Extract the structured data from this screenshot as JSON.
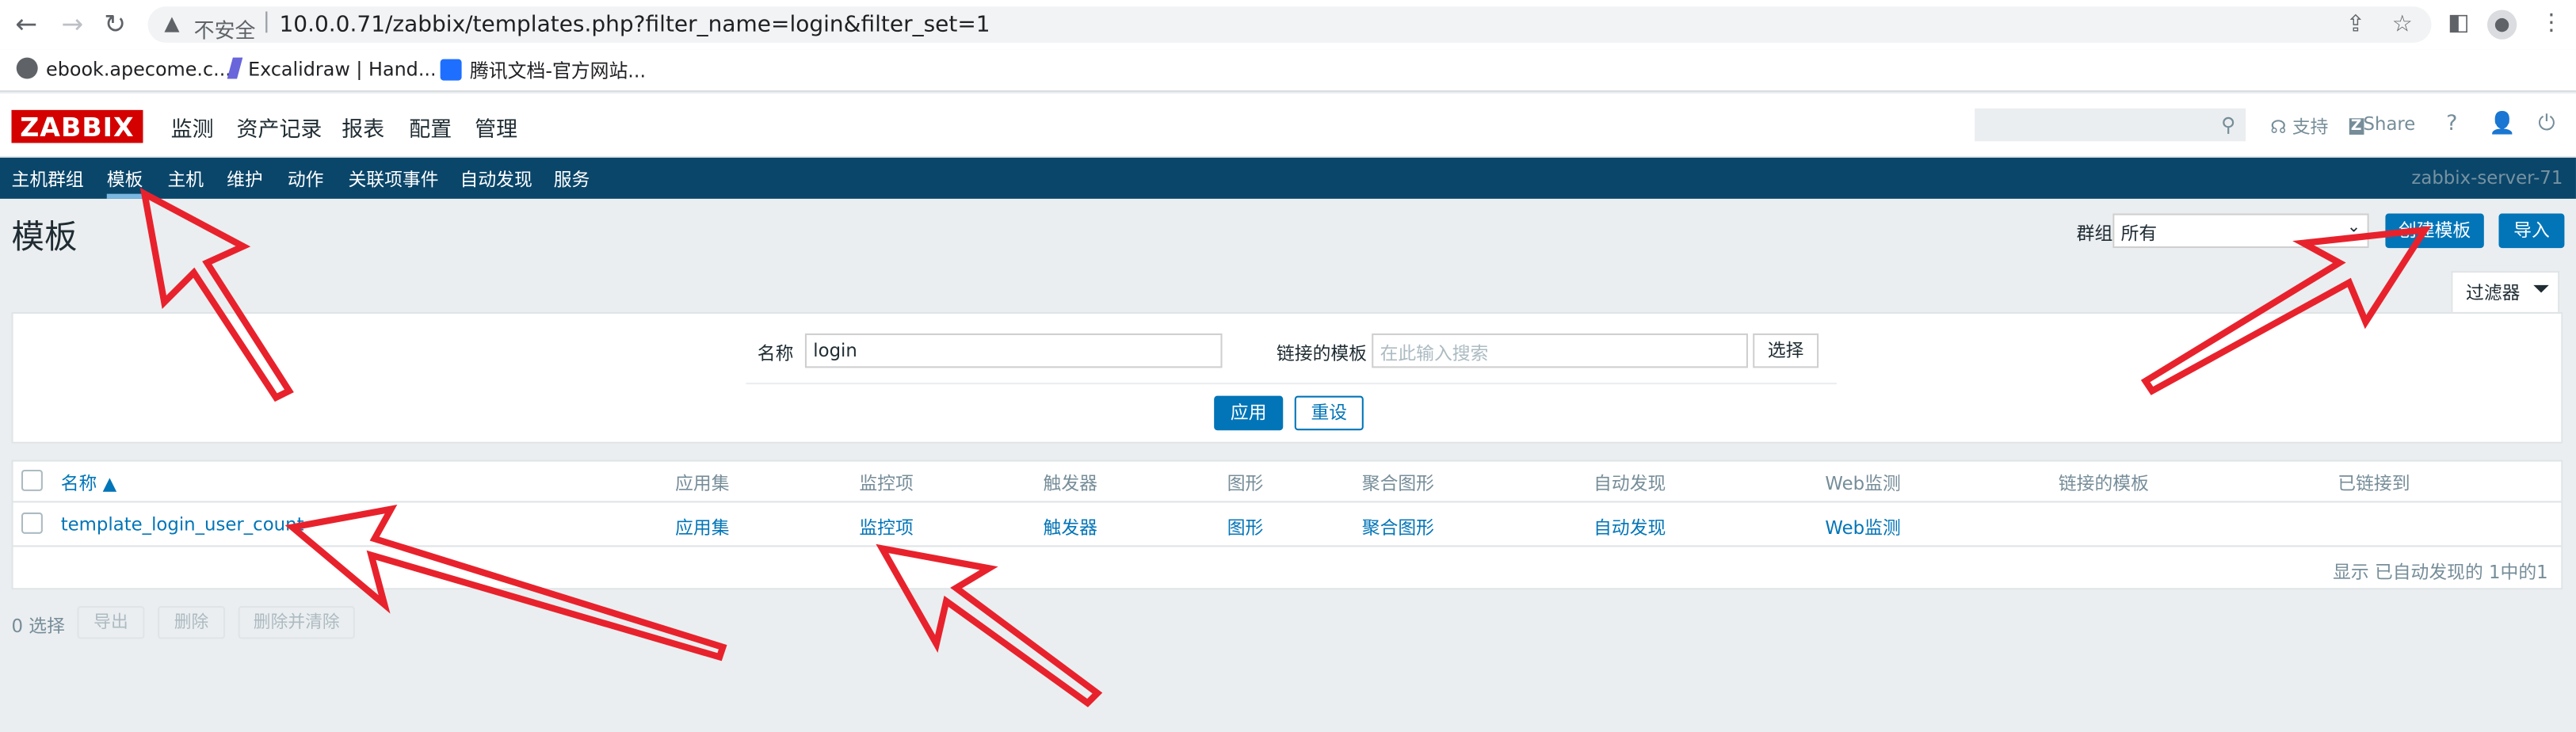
{
  "browser": {
    "insecure_label": "不安全",
    "url": "10.0.0.71/zabbix/templates.php?filter_name=login&filter_set=1",
    "bookmarks": [
      {
        "label": "ebook.apecome.c..."
      },
      {
        "label": "Excalidraw | Hand..."
      },
      {
        "label": "腾讯文档-官方网站..."
      }
    ]
  },
  "header": {
    "logo": "ZABBIX",
    "menu": [
      {
        "label": "监测"
      },
      {
        "label": "资产记录"
      },
      {
        "label": "报表"
      },
      {
        "label": "配置"
      },
      {
        "label": "管理"
      }
    ],
    "support_label": "支持",
    "share_label": "Share",
    "help_label": "?"
  },
  "submenu": {
    "items": [
      {
        "label": "主机群组"
      },
      {
        "label": "模板"
      },
      {
        "label": "主机"
      },
      {
        "label": "维护"
      },
      {
        "label": "动作"
      },
      {
        "label": "关联项事件"
      },
      {
        "label": "自动发现"
      },
      {
        "label": "服务"
      }
    ],
    "server_name": "zabbix-server-71"
  },
  "page": {
    "title": "模板",
    "group_label": "群组",
    "group_value": "所有",
    "create_button": "创建模板",
    "import_button": "导入"
  },
  "filter": {
    "tab_label": "过滤器",
    "name_label": "名称",
    "name_value": "login",
    "linked_label": "链接的模板",
    "linked_placeholder": "在此输入搜索",
    "select_button": "选择",
    "apply_button": "应用",
    "reset_button": "重设"
  },
  "table": {
    "headers": [
      "名称 ▲",
      "应用集",
      "监控项",
      "触发器",
      "图形",
      "聚合图形",
      "自动发现",
      "Web监测",
      "链接的模板",
      "已链接到"
    ],
    "rows": [
      {
        "name": "template_login_user_count",
        "applications": "应用集",
        "items": "监控项",
        "triggers": "触发器",
        "graphs": "图形",
        "screens": "聚合图形",
        "discovery": "自动发现",
        "web": "Web监测"
      }
    ],
    "footer": "显示 已自动发现的 1中的1"
  },
  "actions": {
    "selected_count": "0 选择",
    "export_button": "导出",
    "delete_button": "删除",
    "delete_clear_button": "删除并清除"
  },
  "colors": {
    "annotation_red": "#e8222c",
    "zabbix_nav": "#0a466a",
    "link_blue": "#0275b8",
    "logo_red": "#d40000"
  }
}
